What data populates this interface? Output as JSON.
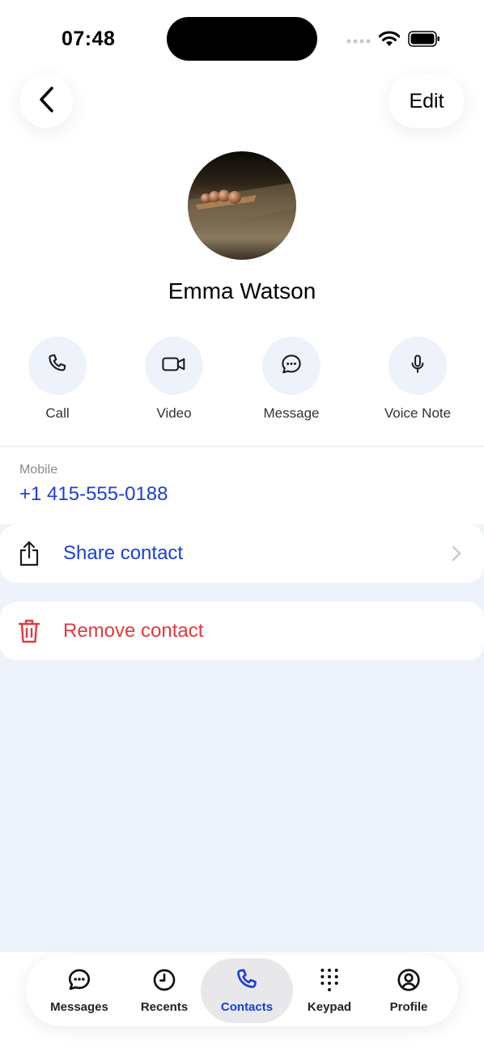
{
  "status": {
    "time": "07:48"
  },
  "header": {
    "edit_label": "Edit"
  },
  "contact": {
    "name": "Emma Watson"
  },
  "actions": [
    {
      "label": "Call",
      "icon": "phone-icon"
    },
    {
      "label": "Video",
      "icon": "video-icon"
    },
    {
      "label": "Message",
      "icon": "message-icon"
    },
    {
      "label": "Voice Note",
      "icon": "mic-icon"
    }
  ],
  "details": {
    "mobile_label": "Mobile",
    "mobile_number": "+1 415-555-0188"
  },
  "options": {
    "share_label": "Share contact",
    "remove_label": "Remove contact"
  },
  "tabs": [
    {
      "label": "Messages",
      "icon": "message-icon",
      "active": false
    },
    {
      "label": "Recents",
      "icon": "clock-icon",
      "active": false
    },
    {
      "label": "Contacts",
      "icon": "phone-icon",
      "active": true
    },
    {
      "label": "Keypad",
      "icon": "keypad-icon",
      "active": false
    },
    {
      "label": "Profile",
      "icon": "profile-icon",
      "active": false
    }
  ],
  "colors": {
    "accent": "#1a3fd6",
    "danger": "#e5383b",
    "background_gray": "#eef2fb",
    "action_circle": "#eef2fa"
  }
}
